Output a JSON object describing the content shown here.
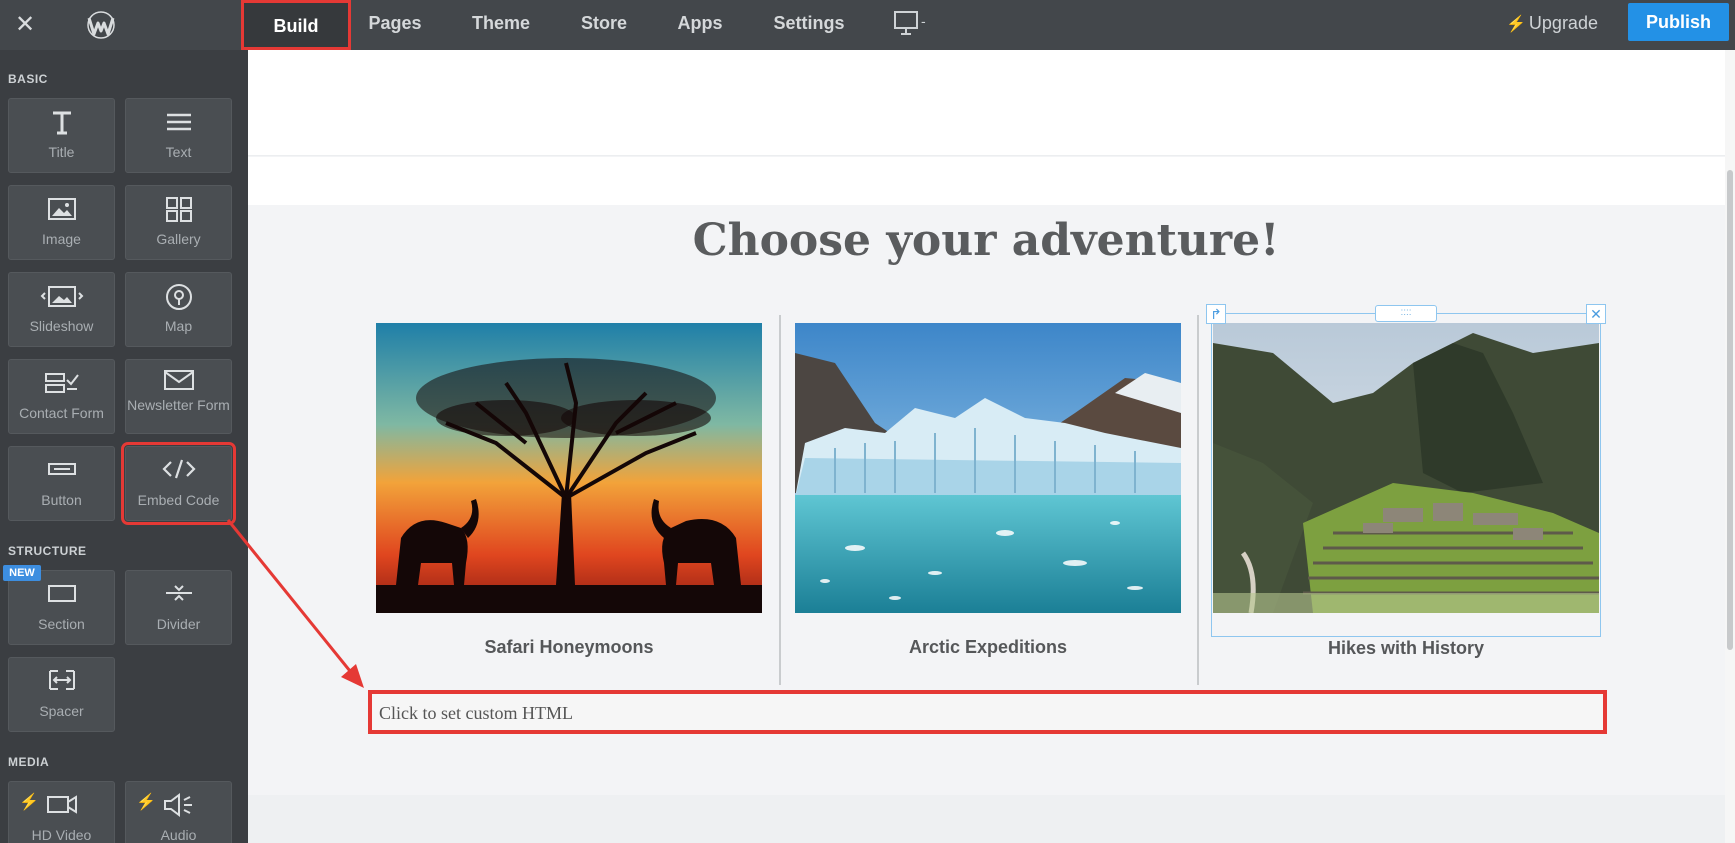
{
  "topbar": {
    "nav": [
      {
        "label": "Build"
      },
      {
        "label": "Pages"
      },
      {
        "label": "Theme"
      },
      {
        "label": "Store"
      },
      {
        "label": "Apps"
      },
      {
        "label": "Settings"
      }
    ],
    "device_icon": "desktop-icon",
    "device_suffix": "-",
    "upgrade_label": "Upgrade",
    "publish_label": "Publish"
  },
  "sidebar": {
    "sections": [
      {
        "heading": "BASIC"
      },
      {
        "heading": "STRUCTURE"
      },
      {
        "heading": "MEDIA"
      }
    ],
    "tiles": [
      {
        "label": "Title",
        "icon": "title-icon"
      },
      {
        "label": "Text",
        "icon": "text-lines-icon"
      },
      {
        "label": "Image",
        "icon": "image-icon"
      },
      {
        "label": "Gallery",
        "icon": "gallery-grid-icon"
      },
      {
        "label": "Slideshow",
        "icon": "slideshow-icon"
      },
      {
        "label": "Map",
        "icon": "map-pin-icon"
      },
      {
        "label": "Contact Form",
        "icon": "contact-form-icon"
      },
      {
        "label": "Newsletter Form",
        "icon": "envelope-icon"
      },
      {
        "label": "Button",
        "icon": "button-icon"
      },
      {
        "label": "Embed Code",
        "icon": "code-icon"
      },
      {
        "label": "Section",
        "icon": "section-icon"
      },
      {
        "label": "Divider",
        "icon": "divider-icon"
      },
      {
        "label": "Spacer",
        "icon": "spacer-icon"
      },
      {
        "label": "HD Video",
        "icon": "video-icon"
      },
      {
        "label": "Audio",
        "icon": "audio-icon"
      }
    ],
    "new_badge": "NEW"
  },
  "page": {
    "headline": "Choose your adventure!",
    "cards": [
      {
        "caption": "Safari Honeymoons",
        "image": "safari-sunset-elephants"
      },
      {
        "caption": "Arctic Expeditions",
        "image": "glacier-lagoon"
      },
      {
        "caption": "Hikes with History",
        "image": "machu-picchu-ruins"
      }
    ],
    "embed_placeholder": "Click to set custom HTML"
  },
  "colors": {
    "topbar": "#43474b",
    "sidebar": "#3b3e42",
    "publish": "#2391e6",
    "highlight": "#e53935",
    "selection": "#8ec6ef"
  }
}
